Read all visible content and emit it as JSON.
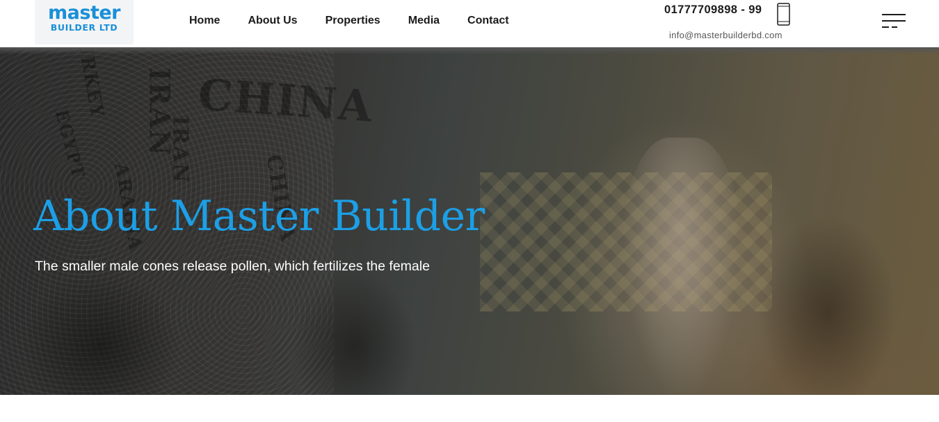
{
  "header": {
    "logo": {
      "line1": "master",
      "line2": "BUILDER LTD"
    },
    "nav": [
      {
        "label": "Home"
      },
      {
        "label": "About Us"
      },
      {
        "label": "Properties"
      },
      {
        "label": "Media"
      },
      {
        "label": "Contact"
      }
    ],
    "phone": "01777709898 - 99",
    "email": "info@masterbuilderbd.com",
    "icons": {
      "phone": "mobile-phone-icon",
      "menu": "hamburger-menu-icon"
    }
  },
  "hero": {
    "title": "About Master Builder",
    "subtitle": "The smaller male cones release pollen, which fertilizes the female",
    "wall_words": [
      "CHINA",
      "IRAN",
      "IRAN",
      "ARABIA",
      "TURKEY",
      "EGYPT",
      "CHINA"
    ],
    "background_image": "office-meeting-photo"
  },
  "colors": {
    "accent": "#1c9fe6",
    "logo": "#1a8fd8",
    "nav_text": "#1b1b1b"
  }
}
